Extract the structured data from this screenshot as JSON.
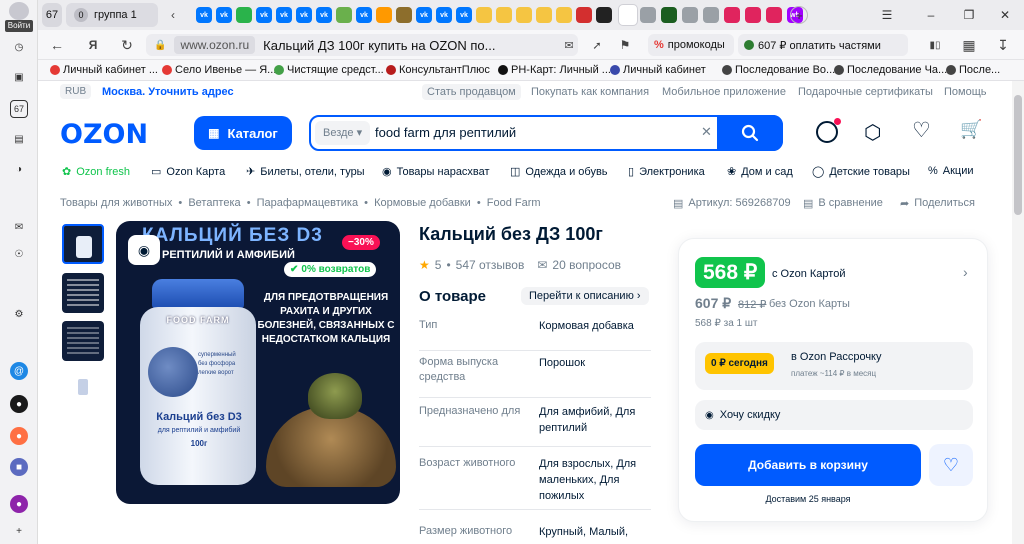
{
  "sidebar": {
    "login_label": "Войти",
    "count_badge": "67"
  },
  "tabs": {
    "count": "67",
    "group_count": "0",
    "group_label": "группа 1",
    "mini": [
      {
        "label": "vk",
        "color": "#0077ff"
      },
      {
        "label": "vk",
        "color": "#0077ff"
      },
      {
        "label": "",
        "color": "#2ab34b"
      },
      {
        "label": "vk",
        "color": "#0077ff"
      },
      {
        "label": "vk",
        "color": "#0077ff"
      },
      {
        "label": "vk",
        "color": "#0077ff"
      },
      {
        "label": "vk",
        "color": "#0077ff"
      },
      {
        "label": "",
        "color": "#6ab04c"
      },
      {
        "label": "vk",
        "color": "#0077ff"
      },
      {
        "label": "",
        "color": "#ff9900"
      },
      {
        "label": "",
        "color": "#8d6e2c"
      },
      {
        "label": "vk",
        "color": "#0077ff"
      },
      {
        "label": "vk",
        "color": "#0077ff"
      },
      {
        "label": "vk",
        "color": "#0077ff"
      },
      {
        "label": "",
        "color": "#f5c542"
      },
      {
        "label": "",
        "color": "#f5c542"
      },
      {
        "label": "",
        "color": "#f5c542"
      },
      {
        "label": "",
        "color": "#f5c542"
      },
      {
        "label": "",
        "color": "#f5c542"
      },
      {
        "label": "",
        "color": "#d32f2f"
      },
      {
        "label": "",
        "color": "#222222"
      }
    ],
    "after": [
      {
        "label": "",
        "color": "#9aa0a6"
      },
      {
        "label": "",
        "color": "#1b5e20"
      },
      {
        "label": "",
        "color": "#9aa0a6"
      },
      {
        "label": "",
        "color": "#9aa0a6"
      },
      {
        "label": "",
        "color": "#e0245e"
      },
      {
        "label": "",
        "color": "#e0245e"
      },
      {
        "label": "",
        "color": "#e0245e"
      },
      {
        "label": "wb",
        "color": "#a100ff"
      }
    ],
    "new_tab": "+"
  },
  "address": {
    "domain": "www.ozon.ru",
    "title": "Кальций ДЗ 100г купить на OZON по...",
    "promo1": "промокоды",
    "promo2": "607 ₽ оплатить частями"
  },
  "bookmarks": [
    {
      "label": "Личный кабинет ...",
      "color": "#e53935"
    },
    {
      "label": "Село Ивенье — Я...",
      "color": "#e53935"
    },
    {
      "label": "Чистящие средст...",
      "color": "#43a047"
    },
    {
      "label": "КонсультантПлюс",
      "color": "#b71c1c"
    },
    {
      "label": "РН-Карт: Личный ...",
      "color": "#111111"
    },
    {
      "label": "Личный кабинет",
      "color": "#3949ab"
    },
    {
      "label": "Последование Во...",
      "color": "#444444"
    },
    {
      "label": "Последование Ча...",
      "color": "#444444"
    },
    {
      "label": "После...",
      "color": "#444444"
    }
  ],
  "topnav": {
    "currency": "RUB",
    "location": "Москва. Уточнить адрес",
    "links": [
      "Стать продавцом",
      "Покупать как компания",
      "Мобильное приложение",
      "Подарочные сертификаты",
      "Помощь"
    ]
  },
  "header": {
    "logo": "OZON",
    "catalog": "Каталог",
    "search_scope": "Везде",
    "search_value": "food farm для рептилий"
  },
  "menu": [
    "Ozon fresh",
    "Ozon Карта",
    "Билеты, отели, туры",
    "Товары нарасхват",
    "Одежда и обувь",
    "Электроника",
    "Дом и сад",
    "Детские товары",
    "Акции"
  ],
  "breadcrumbs": [
    "Товары для животных",
    "Ветаптека",
    "Парафармацевтика",
    "Кормовые добавки",
    "Food Farm"
  ],
  "actions": {
    "article": "Артикул: 569268709",
    "compare": "В сравнение",
    "share": "Поделиться"
  },
  "product": {
    "title": "Кальций без ДЗ 100г",
    "rating": "5",
    "reviews": "547 отзывов",
    "questions": "20 вопросов",
    "about": "О товаре",
    "goto_desc": "Перейти к описанию",
    "image": {
      "banner": "КАЛЬЦИЙ БЕЗ D3",
      "subbanner": "РЕПТИЛИЙ И АМФИБИЙ",
      "discount": "−30%",
      "returns": "0% возвратов",
      "text": "ДЛЯ ПРЕДОТВРАЩЕНИЯ РАХИТА И ДРУГИХ БОЛЕЗНЕЙ, СВЯЗАННЫХ С НЕДОСТАТКОМ КАЛЬЦИЯ",
      "jar_brand": "FOOD FARM",
      "jar_title": "Кальций без D3",
      "jar_sub": "для рептилий и амфибий",
      "jar_weight": "100г",
      "jar_points": [
        "суперменный",
        "без фосфора",
        "легкие ворот"
      ]
    },
    "specs": [
      {
        "label": "Тип",
        "value": "Кормовая добавка"
      },
      {
        "label": "Форма выпуска средства",
        "value": "Порошок"
      },
      {
        "label": "Предназначено для",
        "value": "Для амфибий, Для рептилий"
      },
      {
        "label": "Возраст животного",
        "value": "Для взрослых, Для маленьких, Для пожилых"
      },
      {
        "label": "Размер животного",
        "value": "Крупный, Малый,"
      }
    ]
  },
  "buy": {
    "card_price": "568 ₽",
    "card_label": "с Ozon Картой",
    "price": "607 ₽",
    "old_price": "812 ₽",
    "no_card": "без Ozon Карты",
    "unit": "568 ₽ за 1 шт",
    "installment_badge": "0 ₽ сегодня",
    "installment_title": "в Ozon Рассрочку",
    "installment_sub": "платеж ~114 ₽ в месяц",
    "discount_label": "Хочу скидку",
    "add_to_cart": "Добавить в корзину",
    "delivery": "Доставим 25 января"
  },
  "colors": {
    "brand": "#005bff",
    "green": "#10c44c",
    "accent_pink": "#f91155"
  }
}
